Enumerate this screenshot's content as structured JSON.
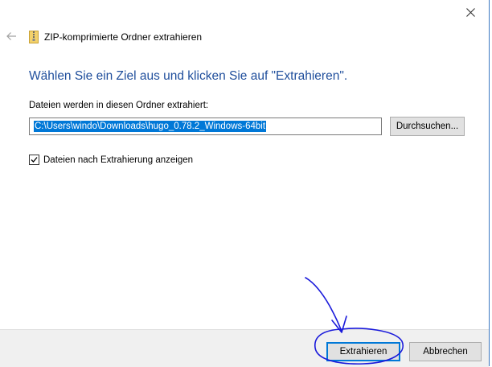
{
  "window": {
    "close_glyph": "close-icon",
    "back_glyph": "back-arrow-icon"
  },
  "header": {
    "title": "ZIP-komprimierte Ordner extrahieren",
    "icon": "zip-folder-icon"
  },
  "main": {
    "instruction": "Wählen Sie ein Ziel aus und klicken Sie auf \"Extrahieren\".",
    "destination_label": "Dateien werden in diesen Ordner extrahiert:",
    "destination_path": "C:\\Users\\windo\\Downloads\\hugo_0.78.2_Windows-64bit",
    "browse_label": "Durchsuchen...",
    "show_files_label": "Dateien nach Extrahierung anzeigen",
    "show_files_checked": true
  },
  "footer": {
    "extract_label": "Extrahieren",
    "cancel_label": "Abbrechen"
  },
  "colors": {
    "instruction_text": "#1f4e9c",
    "selection": "#0078d7",
    "annotation_ink": "#1a1adb"
  }
}
